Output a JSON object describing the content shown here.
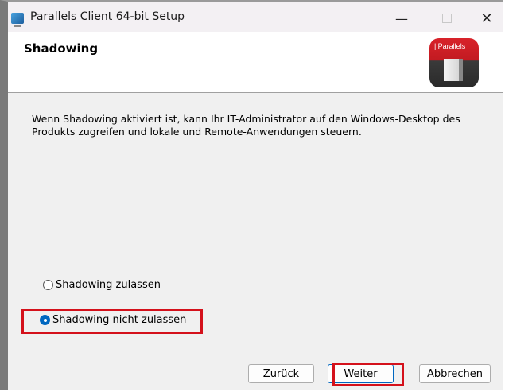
{
  "window": {
    "title": "Parallels Client 64-bit Setup",
    "minimize_glyph": "—",
    "close_glyph": "✕"
  },
  "header": {
    "title": "Shadowing",
    "logo_text": "||Parallels"
  },
  "content": {
    "description": "Wenn Shadowing aktiviert ist, kann Ihr IT-Administrator auf den Windows-Desktop des Produkts zugreifen und lokale und Remote-Anwendungen steuern."
  },
  "options": [
    {
      "label": "Shadowing zulassen",
      "selected": false
    },
    {
      "label": "Shadowing nicht zulassen",
      "selected": true
    }
  ],
  "buttons": {
    "back": "Zurück",
    "next": "Weiter",
    "cancel": "Abbrechen"
  },
  "colors": {
    "accent": "#0067c0",
    "highlight": "#d4111b",
    "logo_red": "#d8232a"
  }
}
